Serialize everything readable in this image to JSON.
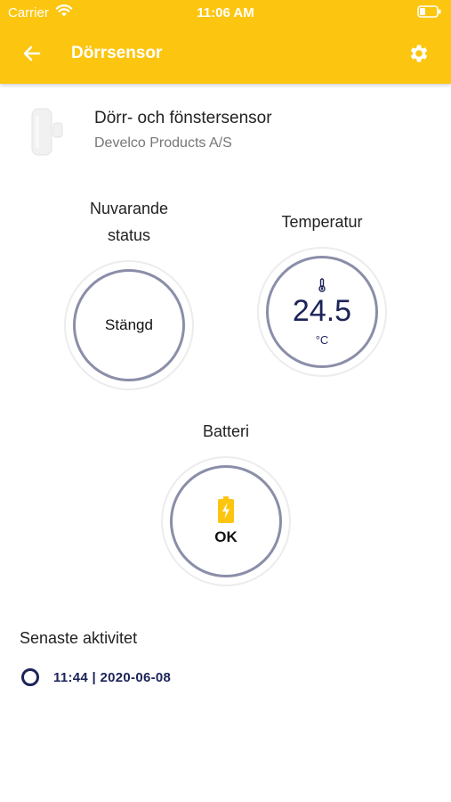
{
  "status_bar": {
    "carrier": "Carrier",
    "time": "11:06 AM"
  },
  "header": {
    "title": "Dörrsensor",
    "back_icon": "arrow-left-icon",
    "settings_icon": "gear-icon",
    "background_color": "#fcc610"
  },
  "device": {
    "name": "Dörr- och fönstersensor",
    "manufacturer": "Develco Products A/S"
  },
  "tiles": {
    "status": {
      "label_line1": "Nuvarande",
      "label_line2": "status",
      "value": "Stängd"
    },
    "temperature": {
      "label": "Temperatur",
      "value": "24.5",
      "unit": "°C",
      "icon": "thermometer-icon"
    },
    "battery": {
      "label": "Batteri",
      "value": "OK",
      "icon": "battery-charging-icon"
    }
  },
  "activity": {
    "title": "Senaste aktivitet",
    "items": [
      {
        "text": "11:44 | 2020-06-08"
      }
    ]
  },
  "colors": {
    "accent": "#fcc610",
    "navy": "#1c2359",
    "ring": "#8a8ea8"
  }
}
